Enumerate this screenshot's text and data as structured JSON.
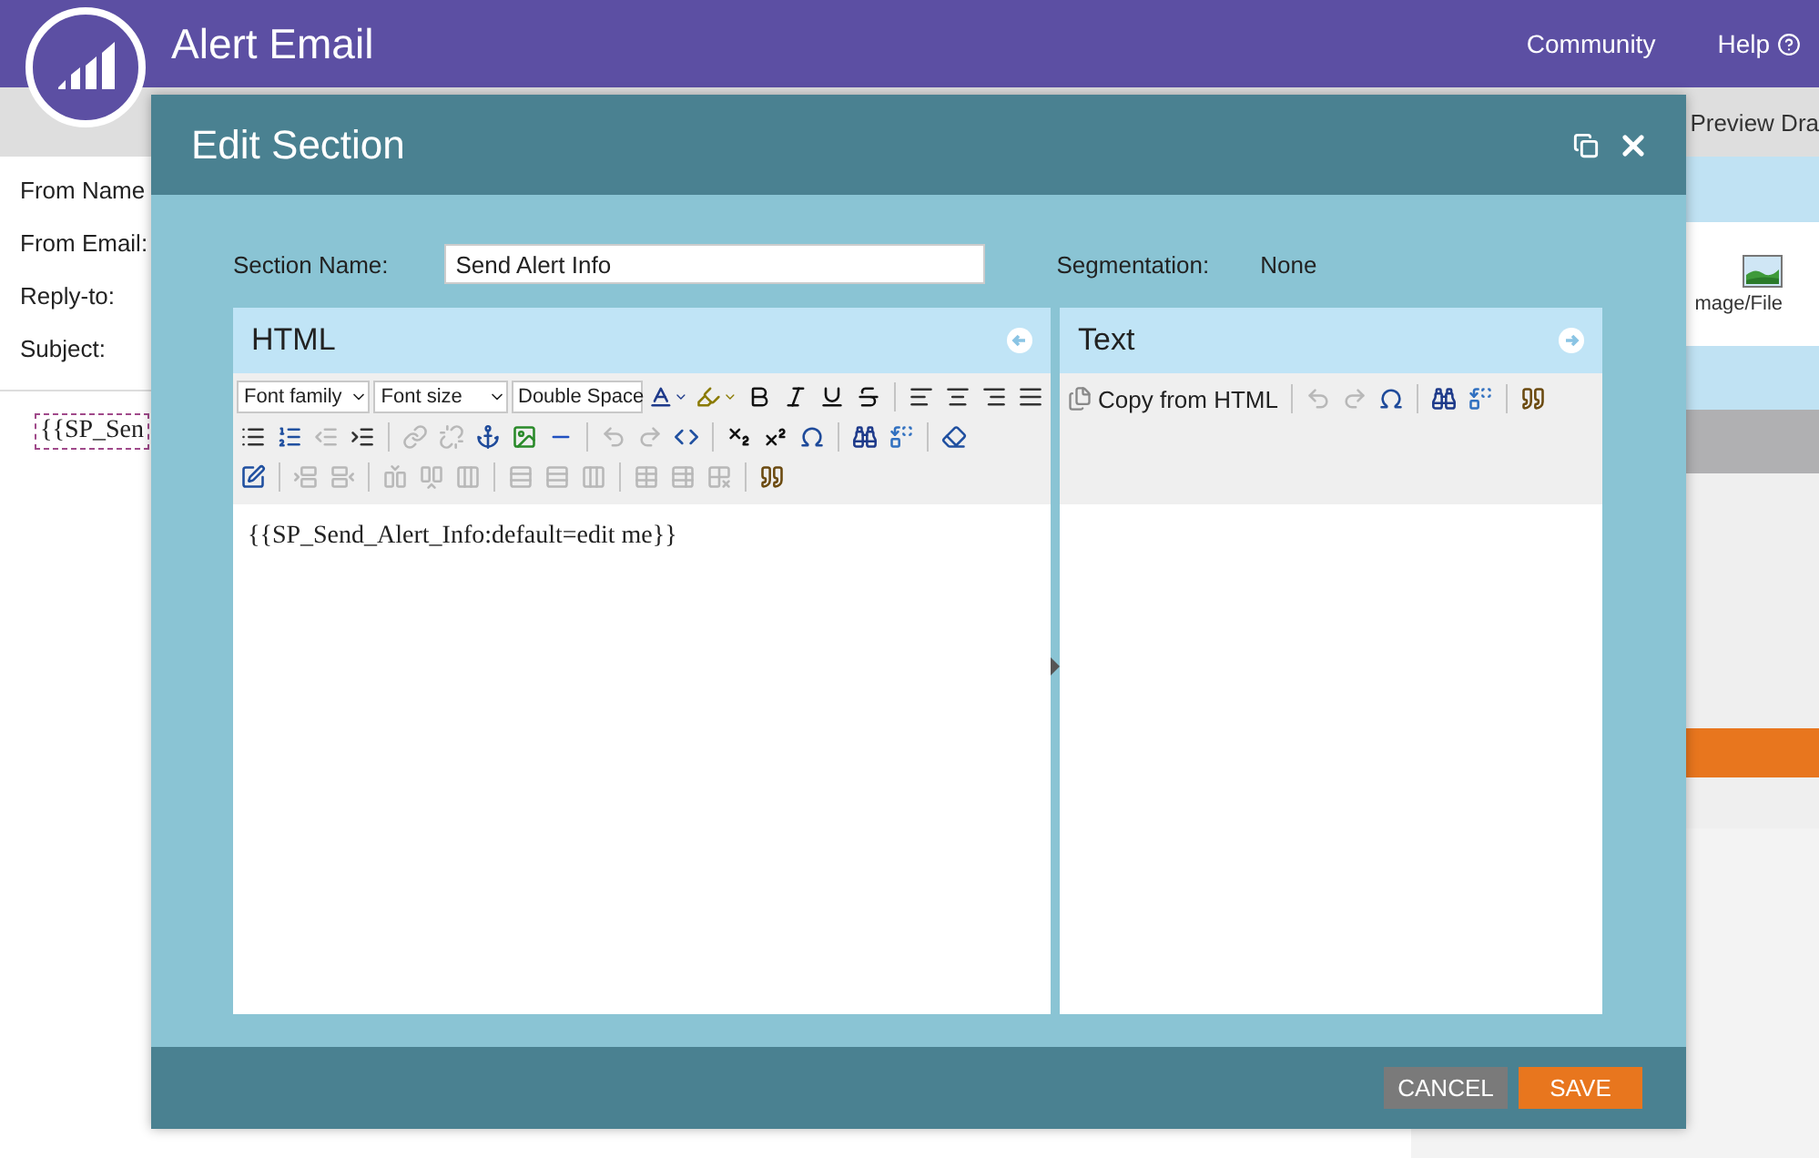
{
  "app_bar": {
    "title": "Alert Email",
    "links": [
      {
        "label": "Community",
        "kind": "plain"
      },
      {
        "label": "Help",
        "kind": "help"
      }
    ]
  },
  "toolbar": {
    "preview_button": "Preview Dra"
  },
  "form": {
    "fields": [
      {
        "label": "From Name"
      },
      {
        "label": "From Email:"
      },
      {
        "label": "Reply-to:"
      },
      {
        "label": "Subject:"
      }
    ],
    "content_token": "{{SP_Sen"
  },
  "side_panel": {
    "insert_item": "mage/File"
  },
  "dialog": {
    "title": "Edit Section",
    "section_name_label": "Section Name:",
    "section_name_value": "Send Alert Info",
    "segmentation_label": "Segmentation:",
    "segmentation_value": "None",
    "panels": [
      {
        "kind": "html",
        "title": "HTML",
        "content": "{{SP_Send_Alert_Info:default=edit me}}",
        "toolbar_rows": [
          [
            {
              "kind": "select",
              "label": "Font family"
            },
            {
              "kind": "select",
              "label": "Font size"
            },
            {
              "kind": "select",
              "label": "Double Space"
            },
            {
              "kind": "tool",
              "disabled": false
            },
            {
              "kind": "tool",
              "disabled": false
            },
            {
              "kind": "tool",
              "disabled": false
            },
            {
              "kind": "tool",
              "disabled": false
            },
            {
              "kind": "tool",
              "disabled": false
            },
            {
              "kind": "tool",
              "disabled": false
            },
            {
              "kind": "sep"
            },
            {
              "kind": "tool",
              "disabled": false
            },
            {
              "kind": "tool",
              "disabled": false
            },
            {
              "kind": "tool",
              "disabled": false
            },
            {
              "kind": "tool",
              "disabled": false
            }
          ],
          [
            {
              "kind": "tool",
              "disabled": false
            },
            {
              "kind": "tool",
              "disabled": false
            },
            {
              "kind": "tool",
              "disabled": true
            },
            {
              "kind": "tool",
              "disabled": false
            },
            {
              "kind": "sep"
            },
            {
              "kind": "tool",
              "disabled": true
            },
            {
              "kind": "tool",
              "disabled": true
            },
            {
              "kind": "tool",
              "disabled": false
            },
            {
              "kind": "tool",
              "disabled": false
            },
            {
              "kind": "tool",
              "disabled": false
            },
            {
              "kind": "sep"
            },
            {
              "kind": "tool",
              "disabled": true
            },
            {
              "kind": "tool",
              "disabled": true
            },
            {
              "kind": "tool",
              "disabled": false
            },
            {
              "kind": "sep"
            },
            {
              "kind": "tool",
              "disabled": false
            },
            {
              "kind": "tool",
              "disabled": false
            },
            {
              "kind": "tool",
              "disabled": false
            },
            {
              "kind": "sep"
            },
            {
              "kind": "tool",
              "disabled": false
            },
            {
              "kind": "tool",
              "disabled": false
            },
            {
              "kind": "sep"
            },
            {
              "kind": "tool",
              "disabled": false
            }
          ],
          [
            {
              "kind": "tool",
              "disabled": false
            },
            {
              "kind": "sep"
            },
            {
              "kind": "tool",
              "disabled": true
            },
            {
              "kind": "tool",
              "disabled": true
            },
            {
              "kind": "sep"
            },
            {
              "kind": "tool",
              "disabled": true
            },
            {
              "kind": "tool",
              "disabled": true
            },
            {
              "kind": "tool",
              "disabled": true
            },
            {
              "kind": "sep"
            },
            {
              "kind": "tool",
              "disabled": true
            },
            {
              "kind": "tool",
              "disabled": true
            },
            {
              "kind": "tool",
              "disabled": true
            },
            {
              "kind": "sep"
            },
            {
              "kind": "tool",
              "disabled": true
            },
            {
              "kind": "tool",
              "disabled": true
            },
            {
              "kind": "tool",
              "disabled": true
            },
            {
              "kind": "sep"
            },
            {
              "kind": "tool",
              "disabled": false
            }
          ]
        ]
      },
      {
        "kind": "text",
        "title": "Text",
        "toolbar_rows": [
          [
            {
              "kind": "text_tool",
              "label": "Copy from HTML"
            },
            {
              "kind": "sep"
            },
            {
              "kind": "tool",
              "disabled": true
            },
            {
              "kind": "tool",
              "disabled": true
            },
            {
              "kind": "tool",
              "disabled": false
            },
            {
              "kind": "sep"
            },
            {
              "kind": "tool",
              "disabled": false
            },
            {
              "kind": "tool",
              "disabled": false
            },
            {
              "kind": "sep"
            },
            {
              "kind": "tool",
              "disabled": false
            }
          ]
        ]
      }
    ],
    "buttons": [
      {
        "kind": "cancel",
        "label": "CANCEL"
      },
      {
        "kind": "save",
        "label": "SAVE"
      }
    ]
  }
}
